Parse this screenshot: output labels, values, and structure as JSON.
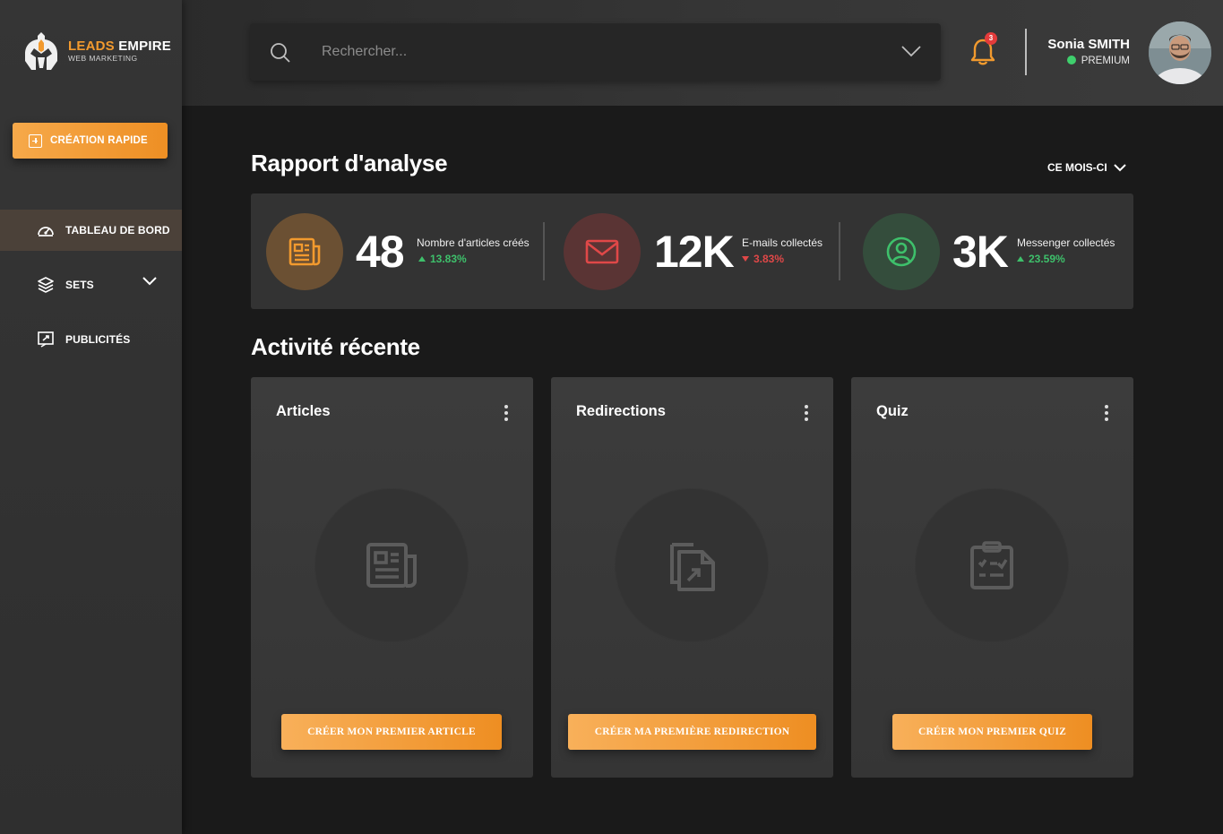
{
  "brand": {
    "name_highlight": "LEADS",
    "name_rest": "EMPIRE",
    "subtitle": "WEB MARKETING"
  },
  "sidebar": {
    "quick_create": "CRÉATION RAPIDE",
    "items": [
      {
        "label": "TABLEAU DE BORD",
        "icon": "speedometer-icon",
        "active": true
      },
      {
        "label": "SETS",
        "icon": "layers-icon",
        "has_dropdown": true
      },
      {
        "label": "PUBLICITÉS",
        "icon": "ads-icon"
      }
    ]
  },
  "search": {
    "placeholder": "Rechercher..."
  },
  "notifications": {
    "count": "3"
  },
  "user": {
    "name": "Sonia SMITH",
    "plan": "PREMIUM",
    "status_color": "#3fcf6d"
  },
  "analytics": {
    "title": "Rapport d'analyse",
    "period": "CE MOIS-CI",
    "stats": [
      {
        "value": "48",
        "label": "Nombre d'articles créés",
        "delta": "13.83%",
        "trend": "up",
        "icon": "newspaper-icon",
        "color": "#f29a2e"
      },
      {
        "value": "12K",
        "label": "E-mails collectés",
        "delta": "3.83%",
        "trend": "down",
        "icon": "mail-icon",
        "color": "#e04848"
      },
      {
        "value": "3K",
        "label": "Messenger collectés",
        "delta": "23.59%",
        "trend": "up",
        "icon": "user-circle-icon",
        "color": "#3ec06b"
      }
    ]
  },
  "activity": {
    "title": "Activité récente",
    "cards": [
      {
        "title": "Articles",
        "button": "CRÉER MON PREMIER ARTICLE",
        "icon": "newspaper-icon"
      },
      {
        "title": "Redirections",
        "button": "CRÉER MA PREMIÈRE REDIRECTION",
        "icon": "file-redirect-icon"
      },
      {
        "title": "Quiz",
        "button": "CRÉER MON PREMIER QUIZ",
        "icon": "clipboard-check-icon"
      }
    ]
  },
  "colors": {
    "accent": "#f29a2e",
    "background": "#1a1a1a",
    "panel": "#333333"
  }
}
